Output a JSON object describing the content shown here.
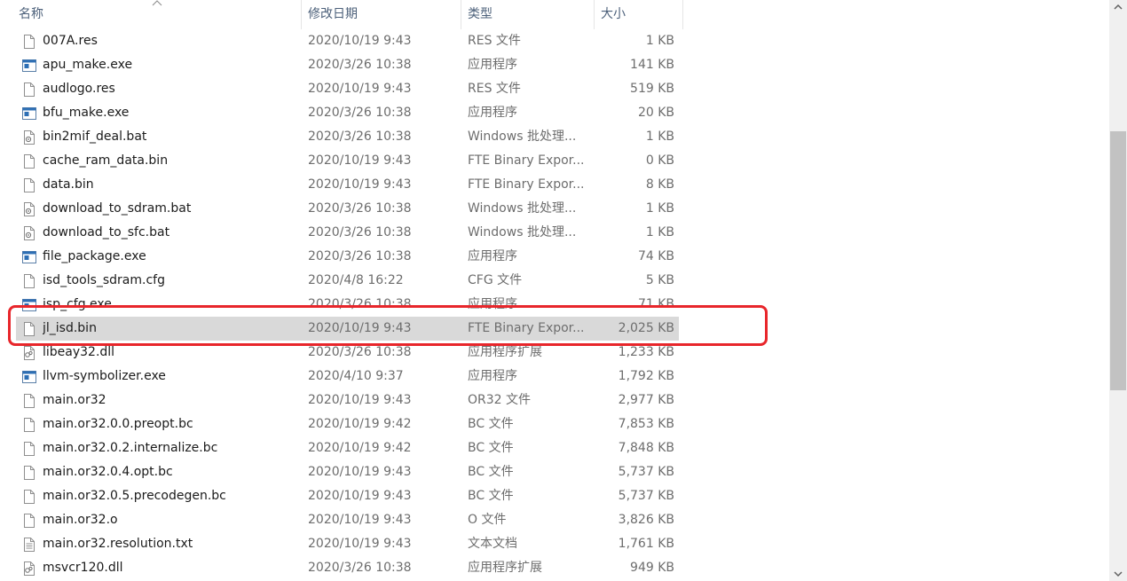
{
  "columns": {
    "name": "名称",
    "date": "修改日期",
    "type": "类型",
    "size": "大小"
  },
  "files": [
    {
      "name": "007A.res",
      "date": "2020/10/19 9:43",
      "type": "RES 文件",
      "size": "1 KB",
      "icon": "file-icon"
    },
    {
      "name": "apu_make.exe",
      "date": "2020/3/26 10:38",
      "type": "应用程序",
      "size": "141 KB",
      "icon": "application-icon"
    },
    {
      "name": "audlogo.res",
      "date": "2020/10/19 9:43",
      "type": "RES 文件",
      "size": "519 KB",
      "icon": "file-icon"
    },
    {
      "name": "bfu_make.exe",
      "date": "2020/3/26 10:38",
      "type": "应用程序",
      "size": "20 KB",
      "icon": "application-icon"
    },
    {
      "name": "bin2mif_deal.bat",
      "date": "2020/3/26 10:38",
      "type": "Windows 批处理...",
      "size": "1 KB",
      "icon": "batch-file-icon"
    },
    {
      "name": "cache_ram_data.bin",
      "date": "2020/10/19 9:43",
      "type": "FTE Binary Expor...",
      "size": "0 KB",
      "icon": "file-icon"
    },
    {
      "name": "data.bin",
      "date": "2020/10/19 9:43",
      "type": "FTE Binary Expor...",
      "size": "8 KB",
      "icon": "file-icon"
    },
    {
      "name": "download_to_sdram.bat",
      "date": "2020/3/26 10:38",
      "type": "Windows 批处理...",
      "size": "1 KB",
      "icon": "batch-file-icon"
    },
    {
      "name": "download_to_sfc.bat",
      "date": "2020/3/26 10:38",
      "type": "Windows 批处理...",
      "size": "1 KB",
      "icon": "batch-file-icon"
    },
    {
      "name": "file_package.exe",
      "date": "2020/3/26 10:38",
      "type": "应用程序",
      "size": "74 KB",
      "icon": "application-icon"
    },
    {
      "name": "isd_tools_sdram.cfg",
      "date": "2020/4/8 16:22",
      "type": "CFG 文件",
      "size": "5 KB",
      "icon": "file-icon"
    },
    {
      "name": "isp_cfg.exe",
      "date": "2020/3/26 10:38",
      "type": "应用程序",
      "size": "71 KB",
      "icon": "application-icon"
    },
    {
      "name": "jl_isd.bin",
      "date": "2020/10/19 9:43",
      "type": "FTE Binary Expor...",
      "size": "2,025 KB",
      "icon": "file-icon",
      "selected": true
    },
    {
      "name": "libeay32.dll",
      "date": "2020/3/26 10:38",
      "type": "应用程序扩展",
      "size": "1,233 KB",
      "icon": "dll-file-icon"
    },
    {
      "name": "llvm-symbolizer.exe",
      "date": "2020/4/10 9:37",
      "type": "应用程序",
      "size": "1,792 KB",
      "icon": "application-icon"
    },
    {
      "name": "main.or32",
      "date": "2020/10/19 9:43",
      "type": "OR32 文件",
      "size": "2,977 KB",
      "icon": "file-icon"
    },
    {
      "name": "main.or32.0.0.preopt.bc",
      "date": "2020/10/19 9:42",
      "type": "BC 文件",
      "size": "7,853 KB",
      "icon": "file-icon"
    },
    {
      "name": "main.or32.0.2.internalize.bc",
      "date": "2020/10/19 9:42",
      "type": "BC 文件",
      "size": "7,848 KB",
      "icon": "file-icon"
    },
    {
      "name": "main.or32.0.4.opt.bc",
      "date": "2020/10/19 9:43",
      "type": "BC 文件",
      "size": "5,737 KB",
      "icon": "file-icon"
    },
    {
      "name": "main.or32.0.5.precodegen.bc",
      "date": "2020/10/19 9:43",
      "type": "BC 文件",
      "size": "5,737 KB",
      "icon": "file-icon"
    },
    {
      "name": "main.or32.o",
      "date": "2020/10/19 9:43",
      "type": "O 文件",
      "size": "3,826 KB",
      "icon": "file-icon"
    },
    {
      "name": "main.or32.resolution.txt",
      "date": "2020/10/19 9:43",
      "type": "文本文档",
      "size": "1,761 KB",
      "icon": "text-file-icon"
    },
    {
      "name": "msvcr120.dll",
      "date": "2020/3/26 10:38",
      "type": "应用程序扩展",
      "size": "949 KB",
      "icon": "dll-file-icon"
    }
  ],
  "colors": {
    "selection": "#d9d9d9",
    "highlight_box": "#e8262b",
    "header_text": "#4c607a"
  }
}
